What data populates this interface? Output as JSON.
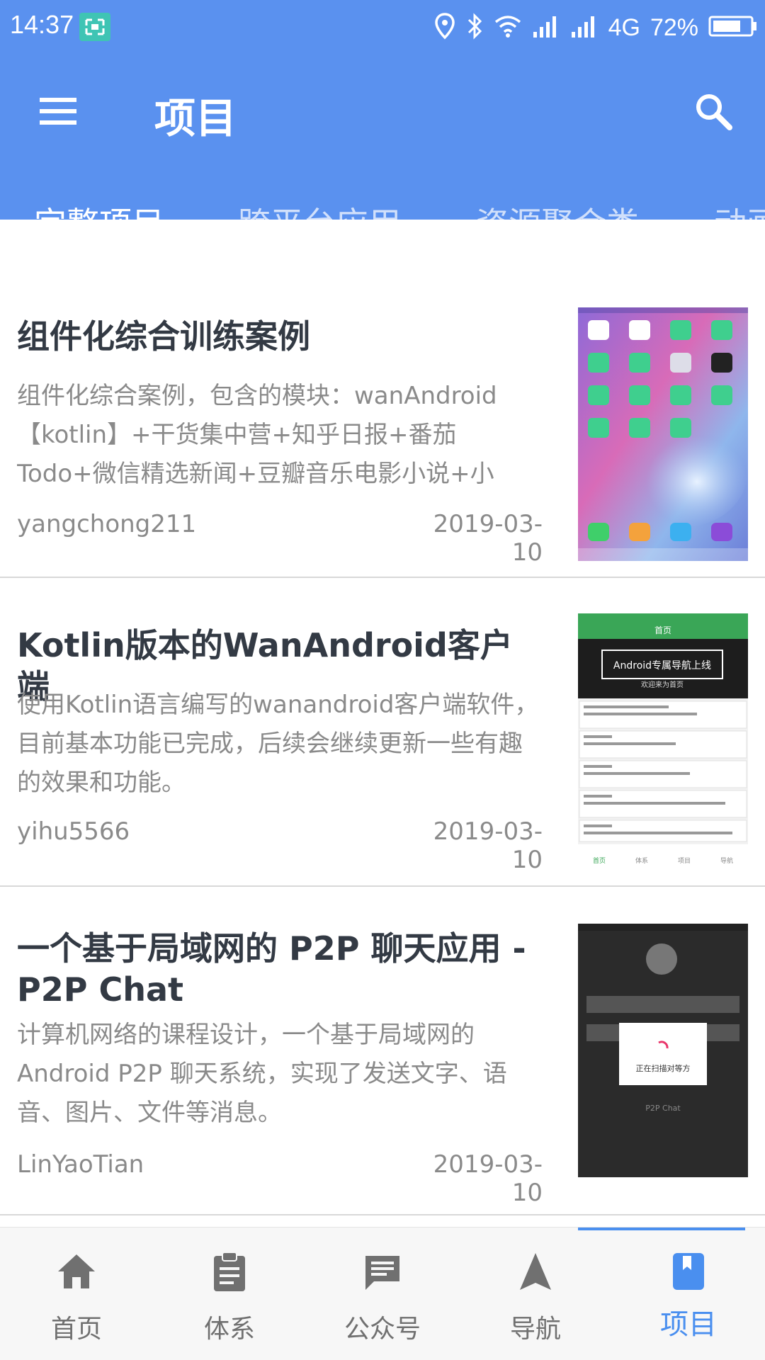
{
  "status_bar": {
    "time": "14:37",
    "network": "4G",
    "battery": "72%",
    "icons": [
      "scan-icon",
      "location-icon",
      "bluetooth-icon",
      "wifi-icon",
      "signal-icon",
      "signal-icon",
      "battery-icon"
    ]
  },
  "app_bar": {
    "title": "项目",
    "menu_icon": "menu-icon",
    "search_icon": "search-icon",
    "background": "#5a91ef"
  },
  "tabs": [
    {
      "label": "完整项目",
      "active": true
    },
    {
      "label": "跨平台应用",
      "active": false
    },
    {
      "label": "资源聚合类",
      "active": false
    },
    {
      "label": "动画",
      "active": false
    }
  ],
  "projects": [
    {
      "title": "组件化综合训练案例",
      "description": "组件化综合案例，包含的模块：wanAndroid【kotlin】+干货集中营+知乎日报+番茄Todo+微信精选新闻+豆瓣音乐电影小说+小",
      "author": "yangchong211",
      "date": "2019-03-10"
    },
    {
      "title": "Kotlin版本的WanAndroid客户端",
      "description": "使用Kotlin语言编写的wanandroid客户端软件，目前基本功能已完成，后续会继续更新一些有趣的效果和功能。",
      "author": "yihu5566",
      "date": "2019-03-10"
    },
    {
      "title": " 一个基于局域网的 P2P 聊天应用 - P2P Chat",
      "description": "计算机网络的课程设计，一个基于局域网的 Android P2P 聊天系统，实现了发送文字、语音、图片、文件等消息。",
      "author": "LinYaoTian",
      "date": "2019-03-10"
    }
  ],
  "thumbnails": {
    "thumb2": {
      "header": "首页",
      "banner": "Android专属导航上线",
      "banner_sub": "欢迎来为首页",
      "tabs": [
        "首页",
        "体系",
        "项目",
        "导航"
      ]
    },
    "thumb3": {
      "dialog": "正在扫描对等方",
      "footer": "P2P Chat"
    }
  },
  "bottom_nav": {
    "active_color": "#4a8fef",
    "items": [
      {
        "label": "首页",
        "icon": "home-icon"
      },
      {
        "label": "体系",
        "icon": "clipboard-icon"
      },
      {
        "label": "公众号",
        "icon": "chat-icon"
      },
      {
        "label": "导航",
        "icon": "navigation-icon"
      },
      {
        "label": "项目",
        "icon": "bookmark-icon",
        "active": true
      }
    ]
  }
}
